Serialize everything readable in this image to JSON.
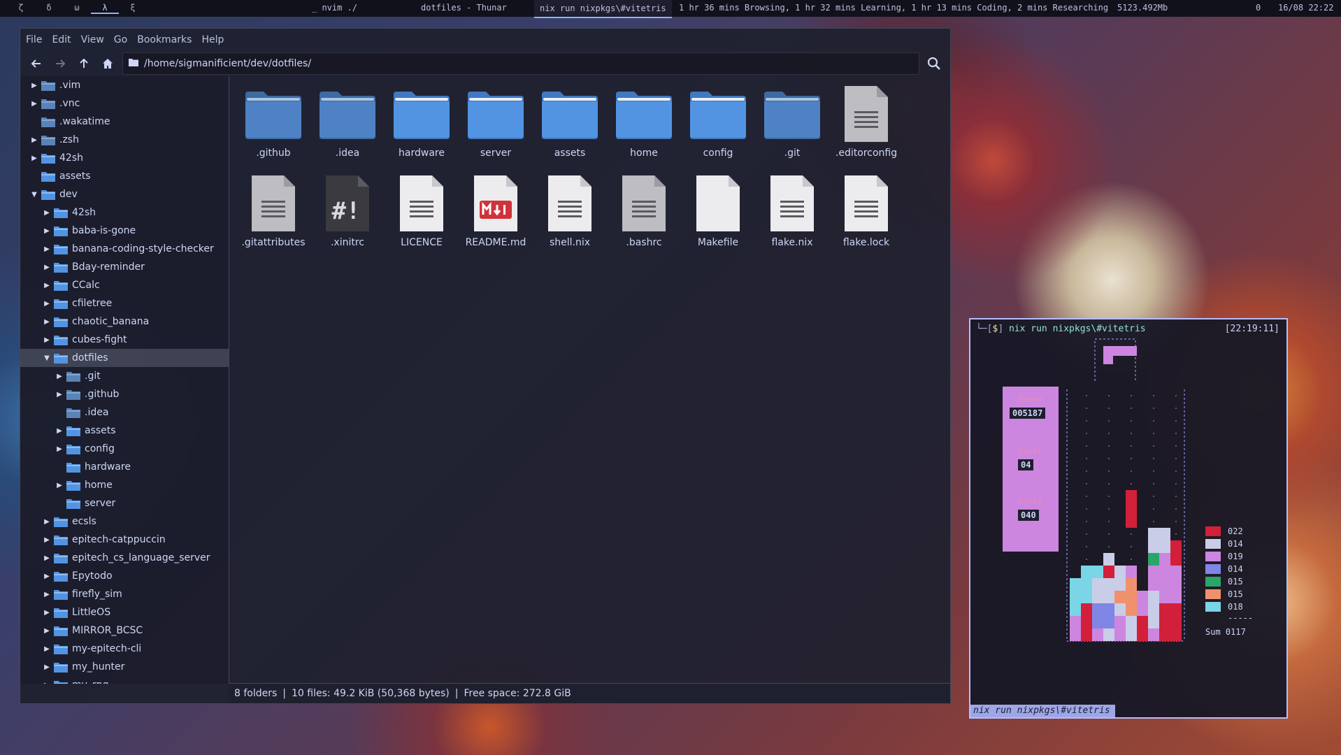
{
  "topbar": {
    "workspaces": [
      "ζ",
      "δ",
      "ω",
      "λ",
      "ξ"
    ],
    "active_workspace": 3,
    "window_nvim": "_ nvim ./",
    "window_thunar": "dotfiles - Thunar",
    "window_term": "nix run nixpkgs\\#vitetris",
    "wakatime": "1 hr 36 mins Browsing, 1 hr 32 mins Learning, 1 hr 13 mins Coding, 2 mins Researching",
    "memory": "5123.492Mb",
    "zero": "0",
    "datetime": "16/08 22:22"
  },
  "thunar": {
    "menu": [
      "File",
      "Edit",
      "View",
      "Go",
      "Bookmarks",
      "Help"
    ],
    "path": "/home/sigmanificient/dev/dotfiles/",
    "tree": [
      {
        "label": ".vim",
        "depth": 0,
        "exp": "collapsed",
        "hidden": true
      },
      {
        "label": ".vnc",
        "depth": 0,
        "exp": "collapsed",
        "hidden": true
      },
      {
        "label": ".wakatime",
        "depth": 0,
        "exp": "none",
        "hidden": true
      },
      {
        "label": ".zsh",
        "depth": 0,
        "exp": "collapsed",
        "hidden": true
      },
      {
        "label": "42sh",
        "depth": 0,
        "exp": "collapsed"
      },
      {
        "label": "assets",
        "depth": 0,
        "exp": "none"
      },
      {
        "label": "dev",
        "depth": 0,
        "exp": "expanded"
      },
      {
        "label": "42sh",
        "depth": 1,
        "exp": "collapsed"
      },
      {
        "label": "baba-is-gone",
        "depth": 1,
        "exp": "collapsed"
      },
      {
        "label": "banana-coding-style-checker",
        "depth": 1,
        "exp": "collapsed"
      },
      {
        "label": "Bday-reminder",
        "depth": 1,
        "exp": "collapsed"
      },
      {
        "label": "CCalc",
        "depth": 1,
        "exp": "collapsed"
      },
      {
        "label": "cfiletree",
        "depth": 1,
        "exp": "collapsed"
      },
      {
        "label": "chaotic_banana",
        "depth": 1,
        "exp": "collapsed"
      },
      {
        "label": "cubes-fight",
        "depth": 1,
        "exp": "collapsed"
      },
      {
        "label": "dotfiles",
        "depth": 1,
        "exp": "expanded",
        "selected": true
      },
      {
        "label": ".git",
        "depth": 2,
        "exp": "collapsed",
        "hidden": true
      },
      {
        "label": ".github",
        "depth": 2,
        "exp": "collapsed",
        "hidden": true
      },
      {
        "label": ".idea",
        "depth": 2,
        "exp": "none",
        "hidden": true
      },
      {
        "label": "assets",
        "depth": 2,
        "exp": "collapsed"
      },
      {
        "label": "config",
        "depth": 2,
        "exp": "collapsed"
      },
      {
        "label": "hardware",
        "depth": 2,
        "exp": "none"
      },
      {
        "label": "home",
        "depth": 2,
        "exp": "collapsed"
      },
      {
        "label": "server",
        "depth": 2,
        "exp": "none"
      },
      {
        "label": "ecsls",
        "depth": 1,
        "exp": "collapsed"
      },
      {
        "label": "epitech-catppuccin",
        "depth": 1,
        "exp": "collapsed"
      },
      {
        "label": "epitech_cs_language_server",
        "depth": 1,
        "exp": "collapsed"
      },
      {
        "label": "Epytodo",
        "depth": 1,
        "exp": "collapsed"
      },
      {
        "label": "firefly_sim",
        "depth": 1,
        "exp": "collapsed"
      },
      {
        "label": "LittleOS",
        "depth": 1,
        "exp": "collapsed"
      },
      {
        "label": "MIRROR_BCSC",
        "depth": 1,
        "exp": "collapsed"
      },
      {
        "label": "my-epitech-cli",
        "depth": 1,
        "exp": "collapsed"
      },
      {
        "label": "my_hunter",
        "depth": 1,
        "exp": "collapsed"
      },
      {
        "label": "my_rpg",
        "depth": 1,
        "exp": "collapsed"
      }
    ],
    "items": [
      {
        "label": ".github",
        "kind": "folder",
        "hidden": true
      },
      {
        "label": ".idea",
        "kind": "folder",
        "hidden": true
      },
      {
        "label": "hardware",
        "kind": "folder"
      },
      {
        "label": "server",
        "kind": "folder"
      },
      {
        "label": "assets",
        "kind": "folder"
      },
      {
        "label": "home",
        "kind": "folder"
      },
      {
        "label": "config",
        "kind": "folder"
      },
      {
        "label": ".git",
        "kind": "folder",
        "hidden": true
      },
      {
        "label": ".editorconfig",
        "kind": "text",
        "hidden": true
      },
      {
        "label": ".gitattributes",
        "kind": "text",
        "hidden": true
      },
      {
        "label": ".xinitrc",
        "kind": "script",
        "hidden": true
      },
      {
        "label": "LICENCE",
        "kind": "text"
      },
      {
        "label": "README.md",
        "kind": "markdown"
      },
      {
        "label": "shell.nix",
        "kind": "text"
      },
      {
        "label": ".bashrc",
        "kind": "text",
        "hidden": true
      },
      {
        "label": "Makefile",
        "kind": "blank"
      },
      {
        "label": "flake.nix",
        "kind": "text"
      },
      {
        "label": "flake.lock",
        "kind": "text"
      }
    ],
    "status": {
      "folders": "8 folders",
      "files": "10 files: 49.2 KiB (50,368 bytes)",
      "free": "Free space: 272.8 GiB",
      "sep": "|"
    }
  },
  "terminal": {
    "prompt_prefix": "└─[",
    "prompt_dollar": "$",
    "prompt_suffix": "]",
    "command": "nix run nixpkgs\\#vitetris",
    "time": "[22:19:11]",
    "score_label": "Score",
    "score": "005187",
    "level_label": "Level",
    "level": "04",
    "lines_label": "Lines",
    "lines": "040",
    "legend": [
      {
        "color": "#d2203a",
        "value": "022"
      },
      {
        "color": "#c9cde8",
        "value": "014"
      },
      {
        "color": "#cc86e0",
        "value": "019"
      },
      {
        "color": "#7f86e6",
        "value": "014"
      },
      {
        "color": "#2aa56a",
        "value": "015"
      },
      {
        "color": "#f0916e",
        "value": "015"
      },
      {
        "color": "#7ad6e6",
        "value": "018"
      }
    ],
    "legend_sep": "-----",
    "sum": "Sum 0117",
    "cmdline": "nix run nixpkgs\\#vitetris"
  },
  "colors": {
    "folder": "#5294e2",
    "folder_hidden": "#5a83b8",
    "accent": "#89b4fa",
    "terminal_border": "#b4befe"
  }
}
